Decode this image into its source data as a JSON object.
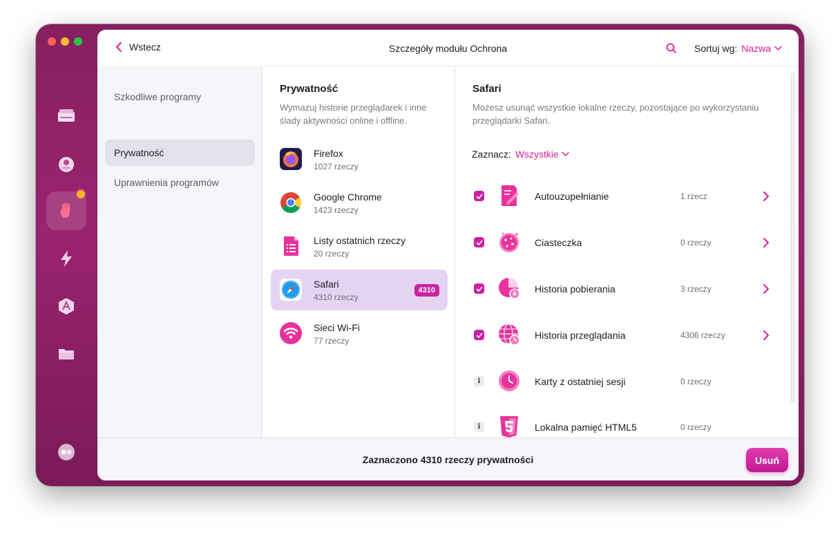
{
  "header": {
    "back_label": "Wstecz",
    "title": "Szczegóły modułu Ochrona",
    "sort_label": "Sortuj wg:",
    "sort_value": "Nazwa"
  },
  "sidebar": {
    "items": [
      {
        "label": "Szkodliwe programy"
      },
      {
        "label": "Prywatność"
      },
      {
        "label": "Uprawnienia programów"
      }
    ]
  },
  "apps_panel": {
    "title": "Prywatność",
    "description_line1": "Wymazuj historie przeglądarek i inne",
    "description_line2": "ślady aktywności online i offline.",
    "apps": [
      {
        "name": "Firefox",
        "count": "1027 rzeczy",
        "icon": "firefox-icon"
      },
      {
        "name": "Google Chrome",
        "count": "1423 rzeczy",
        "icon": "chrome-icon"
      },
      {
        "name": "Listy ostatnich rzeczy",
        "count": "20 rzeczy",
        "icon": "document-list-icon"
      },
      {
        "name": "Safari",
        "count": "4310 rzeczy",
        "badge": "4310",
        "icon": "safari-icon"
      },
      {
        "name": "Sieci Wi-Fi",
        "count": "77 rzeczy",
        "icon": "wifi-icon"
      }
    ]
  },
  "details_panel": {
    "title": "Safari",
    "description_line1": "Możesz usunąć wszystkie lokalne rzeczy, pozostające po wykorzystaniu",
    "description_line2": "przeglądarki Safari.",
    "select_label": "Zaznacz:",
    "select_value": "Wszystkie",
    "items": [
      {
        "name": "Autouzupełnianie",
        "count": "1 rzecz",
        "checked": true,
        "icon": "autofill-icon"
      },
      {
        "name": "Ciasteczka",
        "count": "0 rzeczy",
        "checked": true,
        "icon": "cookie-icon"
      },
      {
        "name": "Historia pobierania",
        "count": "3 rzeczy",
        "checked": true,
        "icon": "download-history-icon"
      },
      {
        "name": "Historia przeglądania",
        "count": "4306 rzeczy",
        "checked": true,
        "icon": "browsing-history-icon"
      },
      {
        "name": "Karty z ostatniej sesji",
        "count": "0 rzeczy",
        "checked": false,
        "info": "i",
        "icon": "clock-icon"
      },
      {
        "name": "Lokalna pamięć HTML5",
        "count": "0 rzeczy",
        "checked": false,
        "info": "i",
        "icon": "html5-icon"
      }
    ]
  },
  "footer": {
    "status": "Zaznaczono 4310 rzeczy prywatności",
    "delete_label": "Usuń"
  },
  "colors": {
    "accent": "#d5208f",
    "window_frame": "#8f2166",
    "badge": "#c822a3",
    "selected_row": "#e4d3f2"
  }
}
